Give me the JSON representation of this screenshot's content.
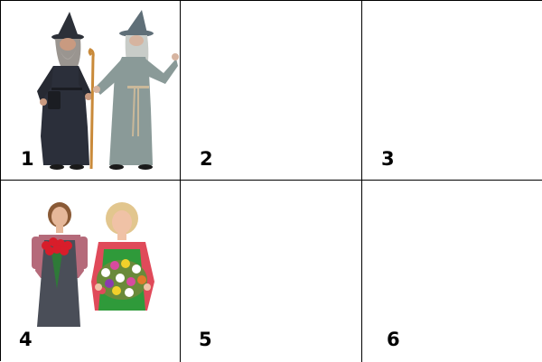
{
  "panels": [
    {
      "number": "1",
      "content": "two-wizards-image"
    },
    {
      "number": "2",
      "content": ""
    },
    {
      "number": "3",
      "content": ""
    },
    {
      "number": "4",
      "content": "two-florists-image"
    },
    {
      "number": "5",
      "content": ""
    },
    {
      "number": "6",
      "content": ""
    }
  ],
  "colors": {
    "border": "#000000",
    "background": "#ffffff",
    "wizard_dark_robe": "#2b2f3a",
    "wizard_grey_robe": "#8a9a98",
    "florist_apron": "#4a4e58",
    "florist_shirt": "#e04a5a",
    "florist_green_apron": "#2f9a3a"
  }
}
